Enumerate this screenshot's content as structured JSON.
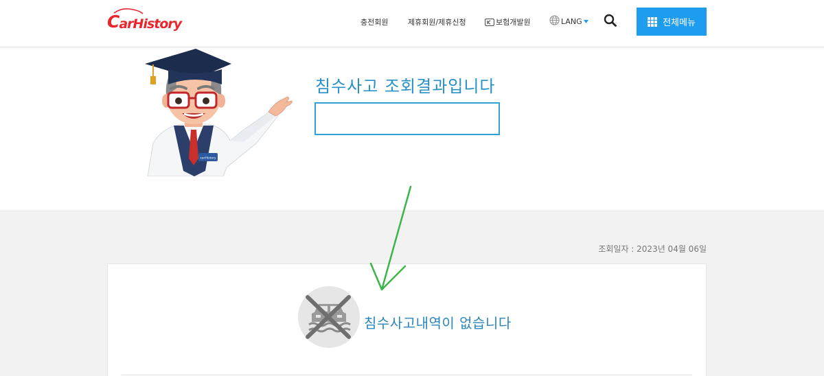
{
  "header": {
    "logo_text_first": "C",
    "logo_text_rest": "arHistory",
    "nav": [
      {
        "label": "충전회원"
      },
      {
        "label": "제휴회원/제휴신청"
      },
      {
        "label": "보험개발원"
      },
      {
        "label": "LANG"
      }
    ],
    "menu_button_label": "전체메뉴"
  },
  "hero": {
    "title": "침수사고 조회결과입니다",
    "result_value": "",
    "badge_text": "carHistory"
  },
  "result": {
    "date_label": "조회일자 : 2023년 04월 06일",
    "message": "침수사고내역이 없습니다"
  },
  "colors": {
    "accent": "#1e9cf0",
    "title_blue": "#2790c9",
    "logo_red": "#e8272d",
    "annotation_green": "#3bb54a"
  }
}
